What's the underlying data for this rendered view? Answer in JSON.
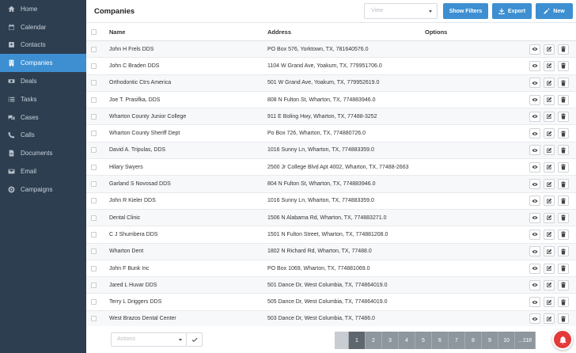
{
  "sidebar": {
    "items": [
      {
        "label": "Home",
        "icon": "home-icon"
      },
      {
        "label": "Calendar",
        "icon": "calendar-icon"
      },
      {
        "label": "Contacts",
        "icon": "contacts-icon"
      },
      {
        "label": "Companies",
        "icon": "building-icon",
        "active": true
      },
      {
        "label": "Deals",
        "icon": "money-icon"
      },
      {
        "label": "Tasks",
        "icon": "tasks-icon"
      },
      {
        "label": "Cases",
        "icon": "cases-icon"
      },
      {
        "label": "Calls",
        "icon": "phone-icon"
      },
      {
        "label": "Documents",
        "icon": "document-icon"
      },
      {
        "label": "Email",
        "icon": "email-icon"
      },
      {
        "label": "Campaigns",
        "icon": "campaign-icon"
      }
    ]
  },
  "header": {
    "title": "Companies",
    "view_placeholder": "View",
    "show_filters": "Show Filters",
    "export": "Export",
    "new": "New"
  },
  "table": {
    "columns": [
      "Name",
      "Address",
      "Options"
    ],
    "rows": [
      {
        "name": "John H Frels DDS",
        "address": "PO Box 576, Yorktown, TX, 781640576.0"
      },
      {
        "name": "John C Braden DDS",
        "address": "1104 W Grand Ave, Yoakum, TX, 779951706.0"
      },
      {
        "name": "Orthodontic Ctrs America",
        "address": "501 W Grand Ave, Yoakum, TX, 779952619.0"
      },
      {
        "name": "Joe T. Prasifka, DDS",
        "address": "808 N Fulton St, Wharton, TX, 774883946.0"
      },
      {
        "name": "Wharton County Junior College",
        "address": "911 E Boling Hwy, Wharton, TX, 77488-3252"
      },
      {
        "name": "Wharton County Sheriff Dept",
        "address": "Po Box 726, Wharton, TX, 774880726.0"
      },
      {
        "name": "David A. Tripulas, DDS",
        "address": "1016 Sunny Ln, Wharton, TX, 774883359.0"
      },
      {
        "name": "Hilary Swyers",
        "address": "2500 Jr College Blvd Apt 4002, Wharton, TX, 77488-2663"
      },
      {
        "name": "Garland S Novosad DDS",
        "address": "804 N Fulton St, Wharton, TX, 774883946.0"
      },
      {
        "name": "John R Kieler DDS",
        "address": "1016 Sunny Ln, Wharton, TX, 774883359.0"
      },
      {
        "name": "Dental Clinic",
        "address": "1506 N Alabama Rd, Wharton, TX, 774883271.0"
      },
      {
        "name": "C J Shumbera DDS",
        "address": "1501 N Fulton Street, Wharton, TX, 774881208.0"
      },
      {
        "name": "Wharton Dent",
        "address": "1802 N Richard Rd, Wharton, TX, 77488.0"
      },
      {
        "name": "John F Bunk Inc",
        "address": "PO Box 1069, Wharton, TX, 774881069.0"
      },
      {
        "name": "Jared L Huvar DDS",
        "address": "501 Dance Dr, West Columbia, TX, 774864019.0"
      },
      {
        "name": "Terry L Driggers DDS",
        "address": "505 Dance Dr, West Columbia, TX, 774864019.0"
      },
      {
        "name": "West Brazos Dental Center",
        "address": "503 Dance Dr, West Columbia, TX, 77486.0"
      }
    ]
  },
  "footer": {
    "actions_placeholder": "Actions",
    "pages": [
      "",
      "1",
      "2",
      "3",
      "4",
      "5",
      "6",
      "7",
      "8",
      "9",
      "10",
      "...118"
    ]
  },
  "colors": {
    "sidebar_bg": "#2c3e50",
    "accent": "#3d8fd1",
    "notification": "#e43a3a"
  }
}
